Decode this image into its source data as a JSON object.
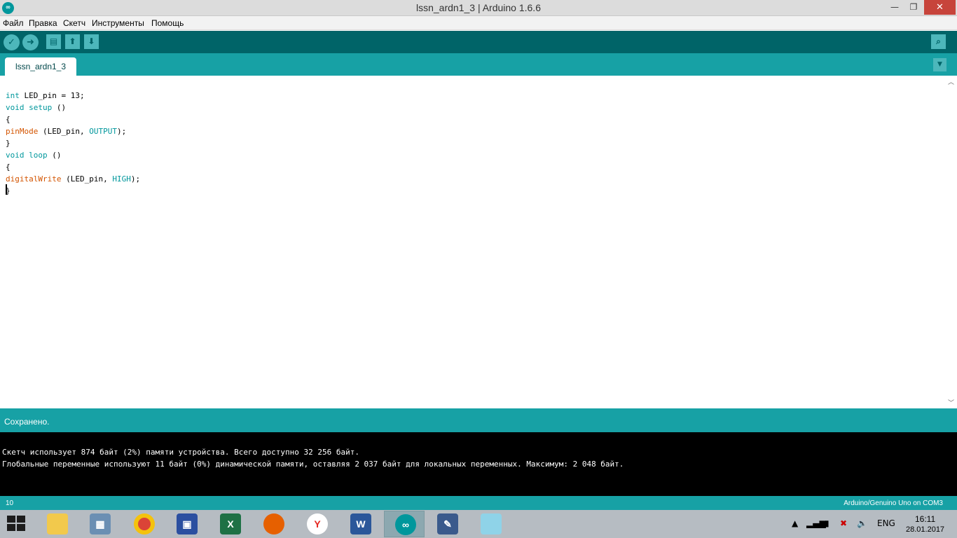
{
  "window": {
    "title": "lssn_ardn1_3 | Arduino 1.6.6",
    "icon": "arduino-icon"
  },
  "menu": [
    "Файл",
    "Правка",
    "Скетч",
    "Инструменты",
    "Помощь"
  ],
  "toolbar": {
    "buttons": [
      "verify-icon",
      "upload-icon",
      "new-icon",
      "open-icon",
      "save-icon",
      "serial-monitor-icon"
    ]
  },
  "tabs": [
    {
      "label": "lssn_ardn1_3"
    }
  ],
  "editor": {
    "lines": [
      "int LED_pin = 13;",
      "void setup ()",
      "{",
      "pinMode (LED_pin, OUTPUT);",
      "}",
      "void loop ()",
      "{",
      "digitalWrite (LED_pin, HIGH);",
      "}"
    ]
  },
  "status": {
    "message": "Сохранено."
  },
  "console": {
    "lines": [
      "Скетч использует 874 байт (2%) памяти устройства. Всего доступно 32 256 байт.",
      "Глобальные переменные используют 11 байт (0%) динамической памяти, оставляя 2 037 байт для локальных переменных. Максимум: 2 048 байт."
    ]
  },
  "footer": {
    "line_number": "10",
    "board": "Arduino/Genuino Uno on COM3"
  },
  "taskbar": {
    "apps": [
      "explorer-icon",
      "calculator-icon",
      "chrome-icon",
      "save-disk-icon",
      "excel-icon",
      "firefox-icon",
      "yandex-icon",
      "word-icon",
      "arduino-icon",
      "paint-icon",
      "notepad-icon"
    ],
    "active_app": "arduino-icon",
    "language": "ENG",
    "time": "16:11",
    "date": "28.01.2017"
  },
  "colors": {
    "teal_dark": "#006468",
    "teal": "#17a1a5",
    "keyword": "#00979c",
    "function": "#d35400"
  }
}
